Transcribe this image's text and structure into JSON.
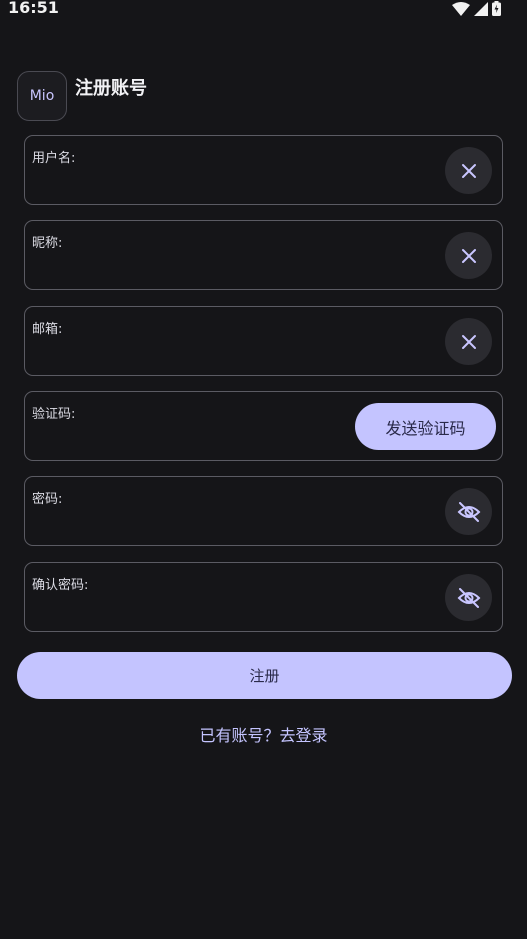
{
  "status_bar": {
    "time": "16:51",
    "icons": [
      "wifi-icon",
      "signal-icon",
      "battery-charging-icon"
    ]
  },
  "header": {
    "logo_text": "Mio",
    "title": "注册账号"
  },
  "form": {
    "username": {
      "label": "用户名:",
      "value": "",
      "action_icon": "close-icon"
    },
    "nickname": {
      "label": "昵称:",
      "value": "",
      "action_icon": "close-icon"
    },
    "email": {
      "label": "邮箱:",
      "value": "",
      "action_icon": "close-icon"
    },
    "code": {
      "label": "验证码:",
      "value": "",
      "send_label": "发送验证码"
    },
    "password": {
      "label": "密码:",
      "value": "",
      "action_icon": "eye-off-icon"
    },
    "confirm_password": {
      "label": "确认密码:",
      "value": "",
      "action_icon": "eye-off-icon"
    }
  },
  "actions": {
    "register_label": "注册",
    "login_link": "已有账号？去登录"
  },
  "colors": {
    "background": "#151518",
    "accent": "#c4c4ff",
    "field_border": "#5b5b63",
    "icon_button_bg": "#2b2b30"
  }
}
